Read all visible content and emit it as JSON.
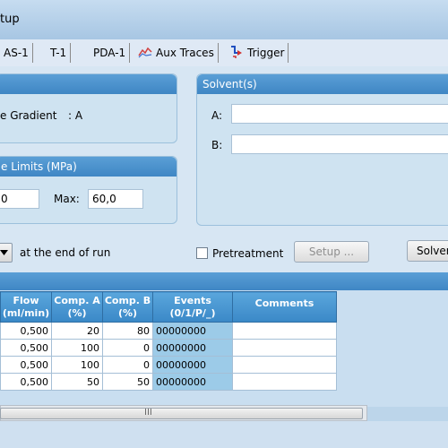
{
  "window": {
    "title": "tup"
  },
  "tabs": [
    {
      "label": "AS-1",
      "icon": ""
    },
    {
      "label": "T-1",
      "icon": ""
    },
    {
      "label": "PDA-1",
      "icon": ""
    },
    {
      "label": "Aux Traces",
      "icon": "aux-traces-chart-icon"
    },
    {
      "label": "Trigger",
      "icon": "trigger-icon"
    }
  ],
  "gradient_panel": {
    "text": "e Gradient",
    "value": ": A"
  },
  "limits_panel": {
    "title": "e Limits (MPa)",
    "min_value": "0",
    "max_label": "Max:",
    "max_value": "60,0"
  },
  "solvents_panel": {
    "title": "Solvent(s)",
    "a_label": "A:",
    "a_value": "",
    "b_label": "B:",
    "b_value": ""
  },
  "run_row": {
    "dropdown_icon": "dropdown-arrow-icon",
    "end_text": "at the end of run",
    "pretreatment_label": "Pretreatment",
    "pretreatment_checked": false,
    "setup_button": "Setup ...",
    "solvent_button": "Solvent"
  },
  "table": {
    "headers": [
      {
        "line1": "Flow",
        "line2": "(ml/min)"
      },
      {
        "line1": "Comp. A",
        "line2": "(%)"
      },
      {
        "line1": "Comp. B",
        "line2": "(%)"
      },
      {
        "line1": "Events",
        "line2": "(0/1/P/_)"
      },
      {
        "line1": "Comments",
        "line2": ""
      }
    ],
    "rows": [
      {
        "flow": "0,500",
        "a": "20",
        "b": "80",
        "events": "00000000",
        "comments": ""
      },
      {
        "flow": "0,500",
        "a": "100",
        "b": "0",
        "events": "00000000",
        "comments": ""
      },
      {
        "flow": "0,500",
        "a": "100",
        "b": "0",
        "events": "00000000",
        "comments": ""
      },
      {
        "flow": "0,500",
        "a": "50",
        "b": "50",
        "events": "00000000",
        "comments": ""
      }
    ]
  },
  "scrollbar": {
    "grip": "III"
  }
}
